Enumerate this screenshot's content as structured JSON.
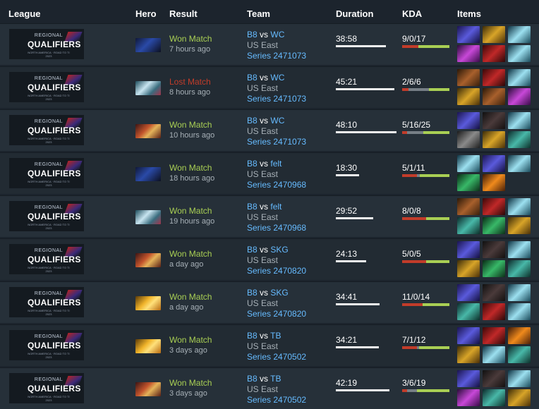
{
  "header": {
    "league": "League",
    "hero": "Hero",
    "result": "Result",
    "team": "Team",
    "duration": "Duration",
    "kda": "KDA",
    "items": "Items"
  },
  "league_badge": {
    "regional": "REGIONAL",
    "title": "QUALIFIERS",
    "subtitle": "NORTH AMERICA · ROAD TO TI 2023"
  },
  "colors": {
    "won": "#a9cf54",
    "lost": "#c23c2a",
    "link": "#66bbff",
    "background": "#1c242d"
  },
  "matches": [
    {
      "hero_icon": "hero-blue-warrior-icon",
      "result": "Won Match",
      "outcome": "won",
      "time": "7 hours ago",
      "team_a": "B8",
      "vs": "vs",
      "team_b": "WC",
      "region": "US East",
      "series": "Series 2471073",
      "duration": "38:58",
      "duration_fraction": 0.83,
      "kda": "9/0/17",
      "kda_deaths_fraction": 0.0,
      "kda_kills_fraction": 0.35,
      "items": [
        "purple-orb-icon",
        "gold-boots-icon",
        "cyan-blade-icon",
        "violet-gem-icon",
        "red-flask-icon",
        "gold-staff-icon"
      ],
      "item_colors": [
        "it-blue",
        "it-gold",
        "it-cyan",
        "it-purple",
        "it-red",
        "it-cyan"
      ]
    },
    {
      "hero_icon": "hero-pale-ghost-icon",
      "result": "Lost Match",
      "outcome": "lost",
      "time": "8 hours ago",
      "team_a": "B8",
      "vs": "vs",
      "team_b": "WC",
      "region": "US East",
      "series": "Series 2471073",
      "duration": "45:21",
      "duration_fraction": 0.97,
      "kda": "2/6/6",
      "kda_deaths_fraction": 0.43,
      "kda_kills_fraction": 0.14,
      "items": [
        "brown-gauntlet-icon",
        "red-orb-icon",
        "cyan-shard-icon",
        "gold-blade-icon",
        "wood-axe-icon",
        "purple-crystal-icon"
      ],
      "item_colors": [
        "it-brown",
        "it-red",
        "it-cyan",
        "it-gold",
        "it-brown",
        "it-purple"
      ]
    },
    {
      "hero_icon": "hero-fire-warrior-icon",
      "result": "Won Match",
      "outcome": "won",
      "time": "10 hours ago",
      "team_a": "B8",
      "vs": "vs",
      "team_b": "WC",
      "region": "US East",
      "series": "Series 2471073",
      "duration": "48:10",
      "duration_fraction": 1.0,
      "kda": "5/16/25",
      "kda_deaths_fraction": 0.35,
      "kda_kills_fraction": 0.11,
      "items": [
        "purple-orb-icon",
        "grey-wing-icon",
        "cyan-blade-icon",
        "white-sword-icon",
        "gold-boots-icon",
        "green-mask-icon"
      ],
      "item_colors": [
        "it-blue",
        "it-dark",
        "it-cyan",
        "it-grey",
        "it-gold",
        "it-teal"
      ]
    },
    {
      "hero_icon": "hero-blue-warrior-icon",
      "result": "Won Match",
      "outcome": "won",
      "time": "18 hours ago",
      "team_a": "B8",
      "vs": "vs",
      "team_b": "felt",
      "region": "US East",
      "series": "Series 2470968",
      "duration": "18:30",
      "duration_fraction": 0.38,
      "kda": "5/1/11",
      "kda_deaths_fraction": 0.06,
      "kda_kills_fraction": 0.31,
      "items": [
        "cyan-wing-icon",
        "blue-wand-icon",
        "cyan-blade-icon",
        "green-staff-icon",
        "orange-flame-icon"
      ],
      "item_colors": [
        "it-cyan",
        "it-blue",
        "it-cyan",
        "it-green",
        "it-orange"
      ]
    },
    {
      "hero_icon": "hero-pale-ghost-icon",
      "result": "Won Match",
      "outcome": "won",
      "time": "19 hours ago",
      "team_a": "B8",
      "vs": "vs",
      "team_b": "felt",
      "region": "US East",
      "series": "Series 2470968",
      "duration": "29:52",
      "duration_fraction": 0.62,
      "kda": "8/0/8",
      "kda_deaths_fraction": 0.0,
      "kda_kills_fraction": 0.5,
      "items": [
        "brown-gauntlet-icon",
        "red-orb-icon",
        "cyan-blade-icon",
        "teal-mask-icon",
        "green-dagger-icon",
        "gold-crown-icon"
      ],
      "item_colors": [
        "it-brown",
        "it-red",
        "it-cyan",
        "it-teal",
        "it-green",
        "it-gold"
      ]
    },
    {
      "hero_icon": "hero-fire-warrior-icon",
      "result": "Won Match",
      "outcome": "won",
      "time": "a day ago",
      "team_a": "B8",
      "vs": "vs",
      "team_b": "SKG",
      "region": "US East",
      "series": "Series 2470820",
      "duration": "24:13",
      "duration_fraction": 0.5,
      "kda": "5/0/5",
      "kda_deaths_fraction": 0.0,
      "kda_kills_fraction": 0.5,
      "items": [
        "purple-orb-icon",
        "grey-wing-icon",
        "cyan-blade-icon",
        "gold-boots-icon",
        "green-spear-icon",
        "green-orb-icon"
      ],
      "item_colors": [
        "it-blue",
        "it-dark",
        "it-cyan",
        "it-gold",
        "it-green",
        "it-teal"
      ]
    },
    {
      "hero_icon": "hero-golden-knight-icon",
      "result": "Won Match",
      "outcome": "won",
      "time": "a day ago",
      "team_a": "B8",
      "vs": "vs",
      "team_b": "SKG",
      "region": "US East",
      "series": "Series 2470820",
      "duration": "34:41",
      "duration_fraction": 0.72,
      "kda": "11/0/14",
      "kda_deaths_fraction": 0.0,
      "kda_kills_fraction": 0.44,
      "items": [
        "purple-orb-icon",
        "grey-wing-icon",
        "cyan-blade-icon",
        "teal-mask-icon",
        "red-whip-icon",
        "blue-trident-icon"
      ],
      "item_colors": [
        "it-blue",
        "it-dark",
        "it-cyan",
        "it-teal",
        "it-red",
        "it-cyan"
      ]
    },
    {
      "hero_icon": "hero-golden-knight-icon",
      "result": "Won Match",
      "outcome": "won",
      "time": "3 days ago",
      "team_a": "B8",
      "vs": "vs",
      "team_b": "TB",
      "region": "US East",
      "series": "Series 2470502",
      "duration": "34:21",
      "duration_fraction": 0.71,
      "kda": "7/1/12",
      "kda_deaths_fraction": 0.05,
      "kda_kills_fraction": 0.32,
      "items": [
        "purple-orb-icon",
        "red-flame-icon",
        "orange-sun-icon",
        "gold-boots-icon",
        "blue-staff-icon",
        "teal-mask-icon"
      ],
      "item_colors": [
        "it-blue",
        "it-red",
        "it-orange",
        "it-gold",
        "it-cyan",
        "it-teal"
      ]
    },
    {
      "hero_icon": "hero-fire-warrior-icon",
      "result": "Won Match",
      "outcome": "won",
      "time": "3 days ago",
      "team_a": "B8",
      "vs": "vs",
      "team_b": "TB",
      "region": "US East",
      "series": "Series 2470502",
      "duration": "42:19",
      "duration_fraction": 0.88,
      "kda": "3/6/19",
      "kda_deaths_fraction": 0.21,
      "kda_kills_fraction": 0.11,
      "items": [
        "purple-orb-icon",
        "grey-wing-icon",
        "cyan-blade-icon",
        "violet-gem-icon",
        "green-orb-icon",
        "gold-staff-icon"
      ],
      "item_colors": [
        "it-blue",
        "it-dark",
        "it-cyan",
        "it-purple",
        "it-teal",
        "it-gold"
      ]
    }
  ]
}
